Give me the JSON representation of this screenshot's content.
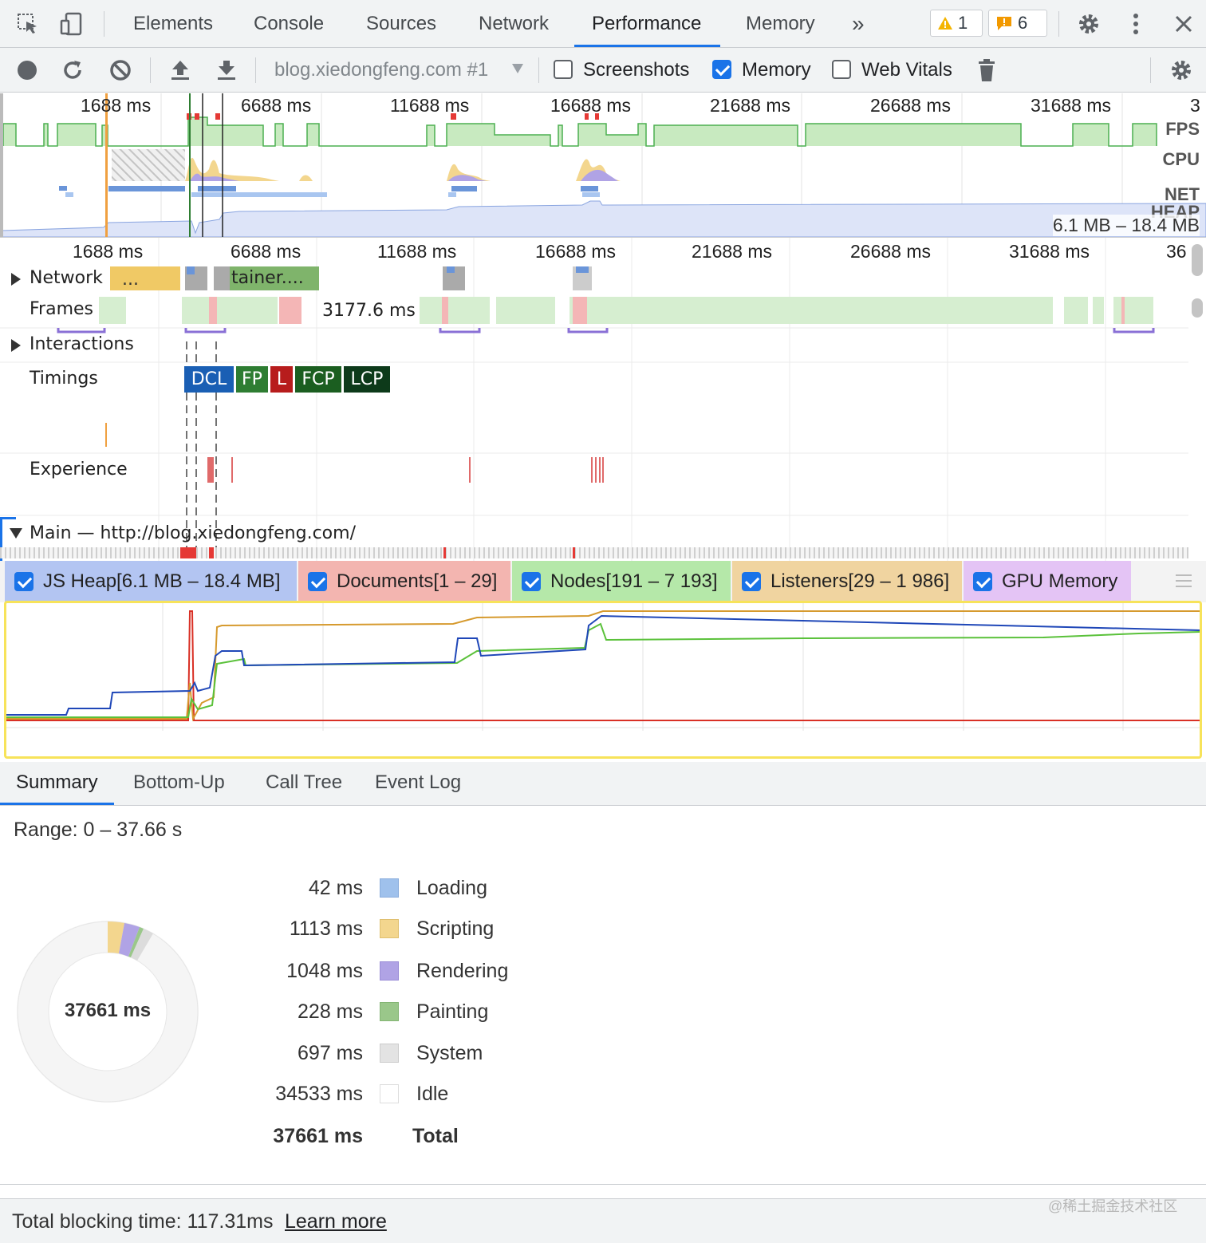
{
  "tabs": {
    "elements": "Elements",
    "console": "Console",
    "sources": "Sources",
    "network": "Network",
    "performance": "Performance",
    "memory": "Memory",
    "more": "»",
    "warnings_count": "1",
    "issues_count": "6"
  },
  "toolbar": {
    "profile_select": "blog.xiedongfeng.com #1",
    "screenshots_label": "Screenshots",
    "screenshots_checked": false,
    "memory_label": "Memory",
    "memory_checked": true,
    "web_vitals_label": "Web Vitals",
    "web_vitals_checked": false
  },
  "overview": {
    "ticks": [
      "1688 ms",
      "6688 ms",
      "11688 ms",
      "16688 ms",
      "21688 ms",
      "26688 ms",
      "31688 ms",
      "3"
    ],
    "fps_label": "FPS",
    "cpu_label": "CPU",
    "net_label": "NET",
    "heap_label": "HEAP",
    "heap_range": "6.1 MB – 18.4 MB"
  },
  "flame": {
    "ticks": [
      "1688 ms",
      "6688 ms",
      "11688 ms",
      "16688 ms",
      "21688 ms",
      "26688 ms",
      "31688 ms",
      "36"
    ],
    "network_label": "Network",
    "network_bar1": "...",
    "network_bar2": "tainer....",
    "frames_label": "Frames",
    "frame_duration": "3177.6 ms",
    "interactions_label": "Interactions",
    "timings_label": "Timings",
    "timings": {
      "dcl": "DCL",
      "fp": "FP",
      "l": "L",
      "fcp": "FCP",
      "lcp": "LCP"
    },
    "experience_label": "Experience",
    "main_label": "Main — http://blog.xiedongfeng.com/"
  },
  "counters": {
    "js_heap": "JS Heap[6.1 MB – 18.4 MB]",
    "documents": "Documents[1 – 29]",
    "nodes": "Nodes[191 – 7 193]",
    "listeners": "Listeners[29 – 1 986]",
    "gpu": "GPU Memory",
    "colors": {
      "js_heap": "#1f47b8",
      "documents": "#d93025",
      "nodes": "#5ac13a",
      "listeners": "#d69a2e",
      "gpu": "#c266ff"
    }
  },
  "bottom_tabs": {
    "summary": "Summary",
    "bottom_up": "Bottom-Up",
    "call_tree": "Call Tree",
    "event_log": "Event Log"
  },
  "summary": {
    "range": "Range: 0 – 37.66 s",
    "total_center": "37661 ms",
    "rows": [
      {
        "value": "42 ms",
        "name": "Loading",
        "color": "#9fc1ec"
      },
      {
        "value": "1113 ms",
        "name": "Scripting",
        "color": "#f3d68e"
      },
      {
        "value": "1048 ms",
        "name": "Rendering",
        "color": "#b0a3e5"
      },
      {
        "value": "228 ms",
        "name": "Painting",
        "color": "#9ac78a"
      },
      {
        "value": "697 ms",
        "name": "System",
        "color": "#e3e3e3"
      },
      {
        "value": "34533 ms",
        "name": "Idle",
        "color": "#ffffff"
      }
    ],
    "total_value": "37661 ms",
    "total_label": "Total"
  },
  "footer": {
    "tbt": "Total blocking time: 117.31ms",
    "learn_more": "Learn more",
    "watermark": "@稀土掘金技术社区"
  }
}
